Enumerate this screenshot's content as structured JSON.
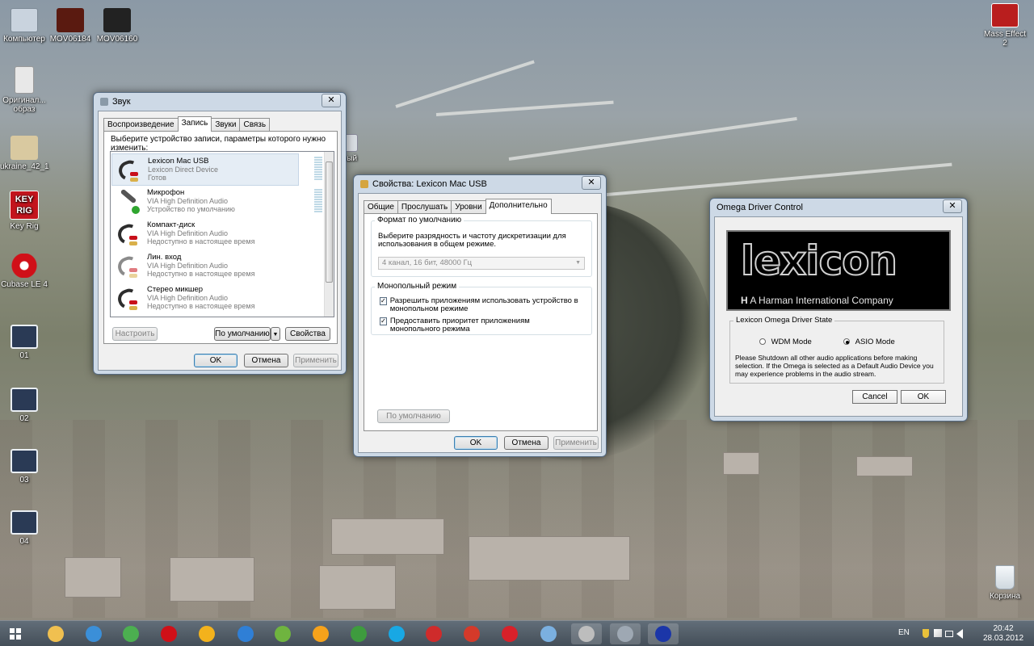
{
  "desktop": {
    "icons": [
      {
        "label": "Компьютер",
        "color": "#c9d3de"
      },
      {
        "label": "MOV06184",
        "color": "#5a1a10"
      },
      {
        "label": "MOV06160",
        "color": "#222222"
      },
      {
        "label": "Оригинал... образ",
        "line2": "образ",
        "color": "#e8e8e8"
      },
      {
        "label": "ukraine_42_1",
        "color": "#d9c9a0"
      },
      {
        "label": "Key Rig",
        "color": "#c3141d"
      },
      {
        "label": "Cubase LE 4",
        "color": "#d01018"
      },
      {
        "label": "01",
        "color": "#e9eef3"
      },
      {
        "label": "02",
        "color": "#e9eef3"
      },
      {
        "label": "03",
        "color": "#e9eef3"
      },
      {
        "label": "04",
        "color": "#e9eef3"
      },
      {
        "label": "Mass Effect 2",
        "color": "#b91e1e"
      },
      {
        "label": "Корзина",
        "color": "#e8edf1"
      }
    ],
    "partial_label": "вый",
    "key_rig_badge": "KEY",
    "key_rig_badge2": "RIG"
  },
  "sound_window": {
    "title": "Звук",
    "close": "✕",
    "tabs": [
      "Воспроизведение",
      "Запись",
      "Звуки",
      "Связь"
    ],
    "active_tab": 1,
    "instruction": "Выберите устройство записи, параметры которого нужно изменить:",
    "devices": [
      {
        "name": "Lexicon Mac USB",
        "driver": "Lexicon Direct Device",
        "status": "Готов"
      },
      {
        "name": "Микрофон",
        "driver": "VIA High Definition Audio",
        "status": "Устройство по умолчанию"
      },
      {
        "name": "Компакт-диск",
        "driver": "VIA High Definition Audio",
        "status": "Недоступно в настоящее время"
      },
      {
        "name": "Лин. вход",
        "driver": "VIA High Definition Audio",
        "status": "Недоступно в настоящее время"
      },
      {
        "name": "Стерео микшер",
        "driver": "VIA High Definition Audio",
        "status": "Недоступно в настоящее время"
      }
    ],
    "buttons": {
      "configure": "Настроить",
      "default": "По умолчанию",
      "properties": "Свойства",
      "ok": "OK",
      "cancel": "Отмена",
      "apply": "Применить"
    }
  },
  "props_window": {
    "title": "Свойства: Lexicon Mac USB",
    "close": "✕",
    "tabs": [
      "Общие",
      "Прослушать",
      "Уровни",
      "Дополнительно"
    ],
    "active_tab": 3,
    "format_group": "Формат по умолчанию",
    "format_desc": "Выберите разрядность и частоту дискретизации для использования в общем режиме.",
    "format_value": "4 канал, 16 бит, 48000 Гц",
    "exclusive_group": "Монопольный режим",
    "exclusive_opt1": "Разрешить приложениям использовать устройство в монопольном режиме",
    "exclusive_opt2": "Предоставить приоритет приложениям монопольного режима",
    "checkmark": "✓",
    "buttons": {
      "restore_default": "По умолчанию",
      "ok": "OK",
      "cancel": "Отмена",
      "apply": "Применить"
    }
  },
  "omega_window": {
    "title": "Omega Driver Control",
    "close": "✕",
    "logo_text": "lexicon",
    "logo_sub_mark": "H",
    "logo_sub": "A Harman International Company",
    "group": "Lexicon Omega Driver State",
    "wdm": "WDM Mode",
    "asio": "ASIO  Mode",
    "selected_mode": "asio",
    "notice": "Please Shutdown all other audio applications before making selection. If the Omega is selected as a Default Audio Device you may experience problems in the audio stream.",
    "buttons": {
      "cancel": "Cancel",
      "ok": "OK"
    }
  },
  "taskbar": {
    "lang": "EN",
    "time": "20:42",
    "date": "28.03.2012",
    "apps": [
      {
        "name": "folder",
        "color": "#f0c050"
      },
      {
        "name": "ie",
        "color": "#3b8fd8"
      },
      {
        "name": "chrome",
        "color": "#4caf50"
      },
      {
        "name": "cubase",
        "color": "#d01018"
      },
      {
        "name": "aimp",
        "color": "#f3b21c"
      },
      {
        "name": "flashget",
        "color": "#2f7fd6"
      },
      {
        "name": "qip",
        "color": "#6fb43f"
      },
      {
        "name": "winamp",
        "color": "#f6a21b"
      },
      {
        "name": "utorrent",
        "color": "#3e9b3e"
      },
      {
        "name": "skype",
        "color": "#18a8e4"
      },
      {
        "name": "red-app",
        "color": "#cf2b2b"
      },
      {
        "name": "nero",
        "color": "#d43a2a"
      },
      {
        "name": "opera",
        "color": "#d8212a"
      },
      {
        "name": "paint",
        "color": "#7bb0e0"
      },
      {
        "name": "settings",
        "color": "#bdbdbd"
      },
      {
        "name": "media-player",
        "color": "#9ea8b3"
      },
      {
        "name": "omega",
        "color": "#1b36a8"
      }
    ]
  }
}
